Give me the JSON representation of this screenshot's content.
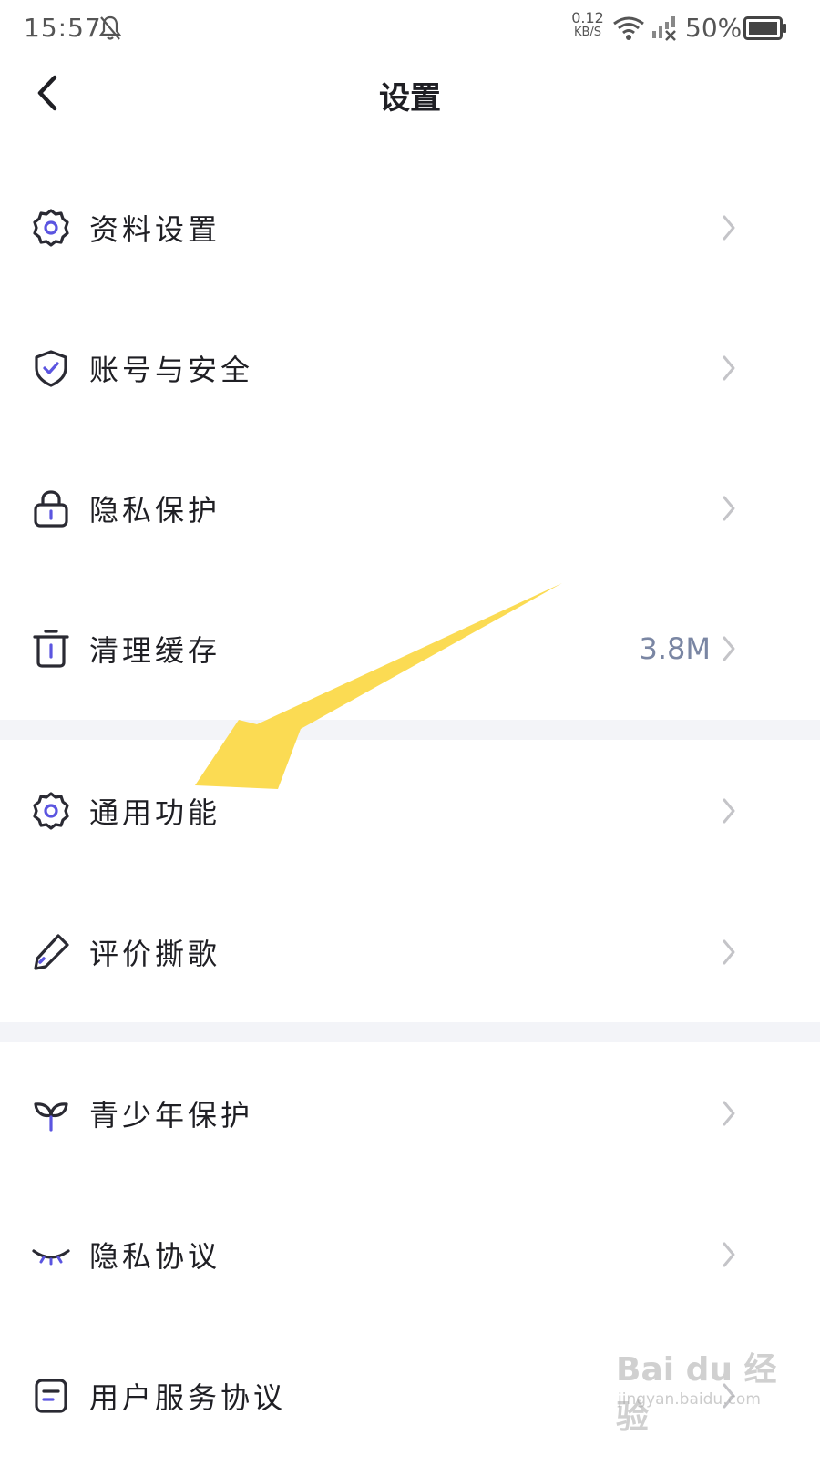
{
  "status_bar": {
    "time": "15:57",
    "net_speed_value": "0.12",
    "net_speed_unit": "KB/S",
    "battery_percent": "50%",
    "icons": [
      "bell-off-icon",
      "wifi-icon",
      "signal-off-icon",
      "battery-icon"
    ]
  },
  "nav": {
    "title": "设置",
    "back_icon": "chevron-left-icon"
  },
  "settings": {
    "items": [
      {
        "label": "资料设置",
        "icon": "gear-icon"
      },
      {
        "label": "账号与安全",
        "icon": "shield-check-icon"
      },
      {
        "label": "隐私保护",
        "icon": "lock-icon"
      },
      {
        "label": "清理缓存",
        "icon": "trash-icon",
        "value": "3.8M"
      },
      {
        "label": "通用功能",
        "icon": "gear-icon"
      },
      {
        "label": "评价撕歌",
        "icon": "pencil-icon"
      },
      {
        "label": "青少年保护",
        "icon": "sprout-icon"
      },
      {
        "label": "隐私协议",
        "icon": "closed-eye-icon"
      },
      {
        "label": "用户服务协议",
        "icon": "document-icon"
      }
    ]
  },
  "annotation": {
    "arrow_color": "#fbd94a",
    "points_to": "通用功能"
  },
  "watermark": {
    "brand": "Bai du 经验",
    "url": "jingyan.baidu.com"
  },
  "colors": {
    "accent": "#5b55e0",
    "icon_stroke": "#2a2a33",
    "divider": "#f3f4f8",
    "value_text": "#7a86a3",
    "chevron": "#c4c4c8"
  }
}
